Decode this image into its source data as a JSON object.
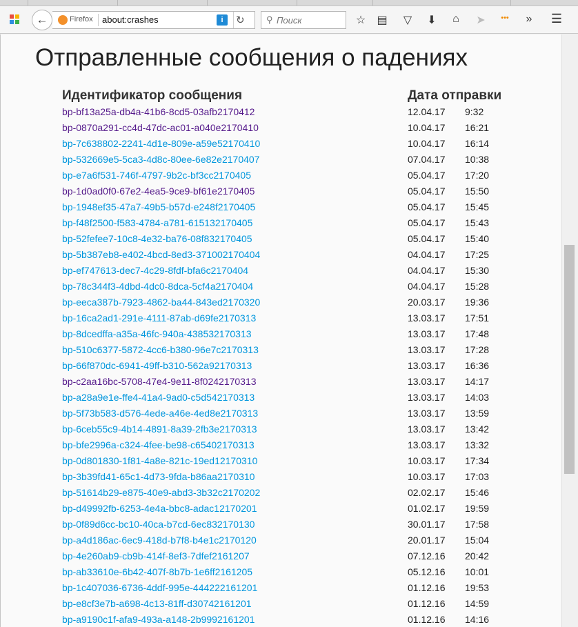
{
  "browser": {
    "identity_label": "Firefox",
    "url": "about:crashes",
    "search_placeholder": "Поиск"
  },
  "page": {
    "title": "Отправленные сообщения о падениях",
    "columns": {
      "id": "Идентификатор сообщения",
      "date": "Дата отправки"
    }
  },
  "colors": {
    "link": "#0096dd",
    "visited_link": "#551a8b"
  },
  "reports": [
    {
      "id": "bp-bf13a25a-db4a-41b6-8cd5-03afb2170412",
      "date": "12.04.17",
      "time": "9:32",
      "visited": true
    },
    {
      "id": "bp-0870a291-cc4d-47dc-ac01-a040e2170410",
      "date": "10.04.17",
      "time": "16:21",
      "visited": true
    },
    {
      "id": "bp-7c638802-2241-4d1e-809e-a59e52170410",
      "date": "10.04.17",
      "time": "16:14",
      "visited": false
    },
    {
      "id": "bp-532669e5-5ca3-4d8c-80ee-6e82e2170407",
      "date": "07.04.17",
      "time": "10:38",
      "visited": false
    },
    {
      "id": "bp-e7a6f531-746f-4797-9b2c-bf3cc2170405",
      "date": "05.04.17",
      "time": "17:20",
      "visited": false
    },
    {
      "id": "bp-1d0ad0f0-67e2-4ea5-9ce9-bf61e2170405",
      "date": "05.04.17",
      "time": "15:50",
      "visited": true
    },
    {
      "id": "bp-1948ef35-47a7-49b5-b57d-e248f2170405",
      "date": "05.04.17",
      "time": "15:45",
      "visited": false
    },
    {
      "id": "bp-f48f2500-f583-4784-a781-615132170405",
      "date": "05.04.17",
      "time": "15:43",
      "visited": false
    },
    {
      "id": "bp-52fefee7-10c8-4e32-ba76-08f832170405",
      "date": "05.04.17",
      "time": "15:40",
      "visited": false
    },
    {
      "id": "bp-5b387eb8-e402-4bcd-8ed3-371002170404",
      "date": "04.04.17",
      "time": "17:25",
      "visited": false
    },
    {
      "id": "bp-ef747613-dec7-4c29-8fdf-bfa6c2170404",
      "date": "04.04.17",
      "time": "15:30",
      "visited": false
    },
    {
      "id": "bp-78c344f3-4dbd-4dc0-8dca-5cf4a2170404",
      "date": "04.04.17",
      "time": "15:28",
      "visited": false
    },
    {
      "id": "bp-eeca387b-7923-4862-ba44-843ed2170320",
      "date": "20.03.17",
      "time": "19:36",
      "visited": false
    },
    {
      "id": "bp-16ca2ad1-291e-4111-87ab-d69fe2170313",
      "date": "13.03.17",
      "time": "17:51",
      "visited": false
    },
    {
      "id": "bp-8dcedffa-a35a-46fc-940a-438532170313",
      "date": "13.03.17",
      "time": "17:48",
      "visited": false
    },
    {
      "id": "bp-510c6377-5872-4cc6-b380-96e7c2170313",
      "date": "13.03.17",
      "time": "17:28",
      "visited": false
    },
    {
      "id": "bp-66f870dc-6941-49ff-b310-562a92170313",
      "date": "13.03.17",
      "time": "16:36",
      "visited": false
    },
    {
      "id": "bp-c2aa16bc-5708-47e4-9e11-8f0242170313",
      "date": "13.03.17",
      "time": "14:17",
      "visited": true
    },
    {
      "id": "bp-a28a9e1e-ffe4-41a4-9ad0-c5d542170313",
      "date": "13.03.17",
      "time": "14:03",
      "visited": false
    },
    {
      "id": "bp-5f73b583-d576-4ede-a46e-4ed8e2170313",
      "date": "13.03.17",
      "time": "13:59",
      "visited": false
    },
    {
      "id": "bp-6ceb55c9-4b14-4891-8a39-2fb3e2170313",
      "date": "13.03.17",
      "time": "13:42",
      "visited": false
    },
    {
      "id": "bp-bfe2996a-c324-4fee-be98-c65402170313",
      "date": "13.03.17",
      "time": "13:32",
      "visited": false
    },
    {
      "id": "bp-0d801830-1f81-4a8e-821c-19ed12170310",
      "date": "10.03.17",
      "time": "17:34",
      "visited": false
    },
    {
      "id": "bp-3b39fd41-65c1-4d73-9fda-b86aa2170310",
      "date": "10.03.17",
      "time": "17:03",
      "visited": false
    },
    {
      "id": "bp-51614b29-e875-40e9-abd3-3b32c2170202",
      "date": "02.02.17",
      "time": "15:46",
      "visited": false
    },
    {
      "id": "bp-d49992fb-6253-4e4a-bbc8-adac12170201",
      "date": "01.02.17",
      "time": "19:59",
      "visited": false
    },
    {
      "id": "bp-0f89d6cc-bc10-40ca-b7cd-6ec832170130",
      "date": "30.01.17",
      "time": "17:58",
      "visited": false
    },
    {
      "id": "bp-a4d186ac-6ec9-418d-b7f8-b4e1c2170120",
      "date": "20.01.17",
      "time": "15:04",
      "visited": false
    },
    {
      "id": "bp-4e260ab9-cb9b-414f-8ef3-7dfef2161207",
      "date": "07.12.16",
      "time": "20:42",
      "visited": false
    },
    {
      "id": "bp-ab33610e-6b42-407f-8b7b-1e6ff2161205",
      "date": "05.12.16",
      "time": "10:01",
      "visited": false
    },
    {
      "id": "bp-1c407036-6736-4ddf-995e-444222161201",
      "date": "01.12.16",
      "time": "19:53",
      "visited": false
    },
    {
      "id": "bp-e8cf3e7b-a698-4c13-81ff-d30742161201",
      "date": "01.12.16",
      "time": "14:59",
      "visited": false
    },
    {
      "id": "bp-a9190c1f-afa9-493a-a148-2b9992161201",
      "date": "01.12.16",
      "time": "14:16",
      "visited": false
    }
  ]
}
